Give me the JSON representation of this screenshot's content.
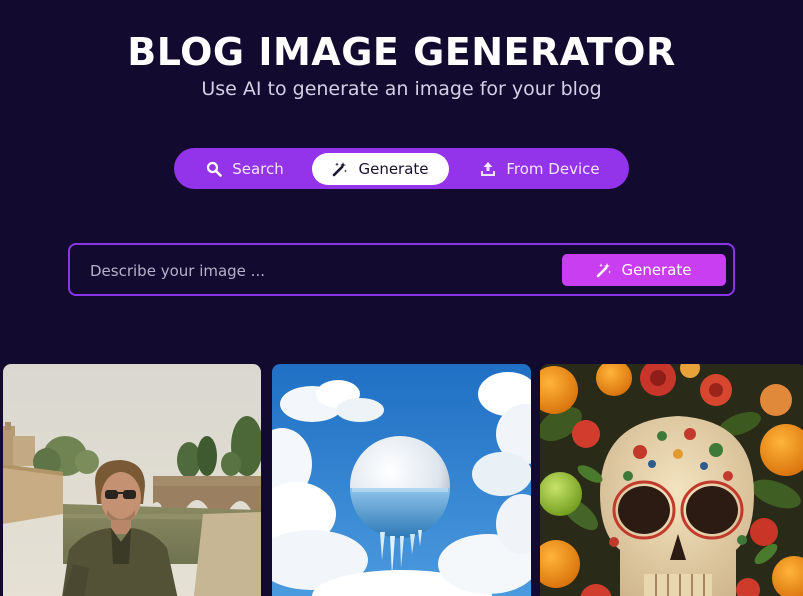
{
  "header": {
    "title": "BLOG IMAGE GENERATOR",
    "subtitle": "Use AI to generate an image for your blog"
  },
  "tabs": [
    {
      "label": "Search",
      "icon": "search-icon",
      "active": false
    },
    {
      "label": "Generate",
      "icon": "magic-wand-icon",
      "active": true
    },
    {
      "label": "From Device",
      "icon": "upload-icon",
      "active": false
    }
  ],
  "prompt": {
    "placeholder": "Describe your image ...",
    "value": "",
    "button_label": "Generate",
    "button_icon": "magic-wand-icon"
  },
  "gallery": {
    "images": [
      {
        "subject": "man-with-sunglasses-by-river-bridge"
      },
      {
        "subject": "sphere-with-water-in-sky-clouds"
      },
      {
        "subject": "decorated-sugar-skull-with-flowers-and-oranges"
      }
    ]
  },
  "colors": {
    "background": "#130a30",
    "tab_bar": "#9333ea",
    "accent_button": "#c93ef0",
    "input_border": "#8b35e8"
  }
}
